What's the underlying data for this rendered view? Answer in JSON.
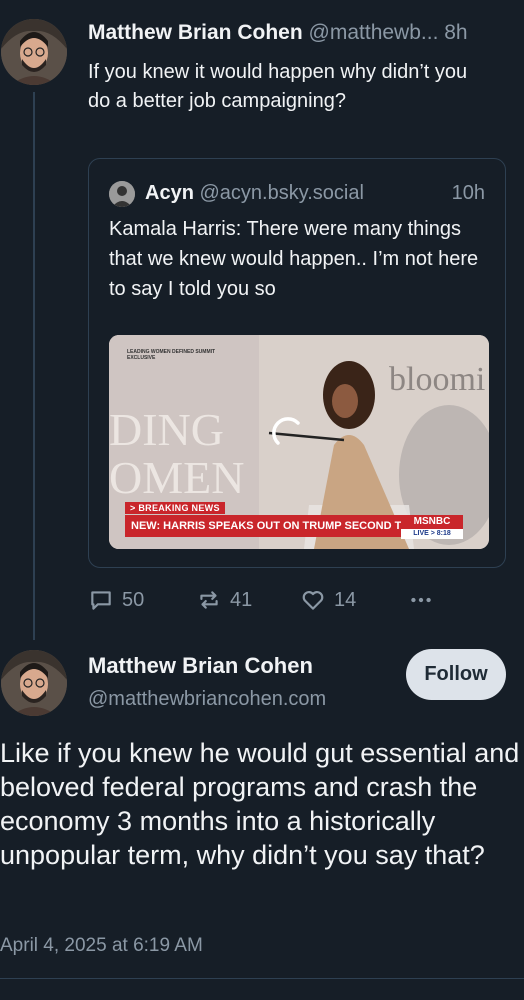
{
  "reply": {
    "author_name": "Matthew Brian Cohen",
    "author_handle": "@matthewb...",
    "time": "8h",
    "text": "If you knew it would happen why didn’t you do a better job campaigning?"
  },
  "quote": {
    "author_name": "Acyn",
    "author_handle": "@acyn.bsky.social",
    "time": "10h",
    "text": "Kamala Harris: There were many things that we knew would happen.. I’m not here to say I told you so",
    "video": {
      "tag_top": "LEADING WOMEN DEFINED SUMMIT\nEXCLUSIVE",
      "breaking_label": "> BREAKING NEWS",
      "headline": "NEW: HARRIS SPEAKS OUT ON TRUMP SECOND TERM CHAOS",
      "network": "MSNBC",
      "live_label": "LIVE > 8:18"
    }
  },
  "actions": {
    "reply_count": "50",
    "repost_count": "41",
    "like_count": "14",
    "reply_icon": "speech-bubble-icon",
    "repost_icon": "repost-arrows-icon",
    "like_icon": "heart-icon",
    "more_icon": "more-dots-icon"
  },
  "main_post": {
    "author_name": "Matthew Brian Cohen",
    "author_handle": "@matthewbriancohen.com",
    "follow_label": "Follow",
    "text": "Like if you knew he would gut essential and beloved federal programs and crash the economy 3 months into a historically unpopular term, why didn’t you say that?",
    "date": "April 4, 2025 at 6:19 AM"
  },
  "colors": {
    "background": "#161e27",
    "muted_text": "#8b98a5",
    "border": "#2e4052",
    "follow_button_bg": "#dde3ea",
    "breaking_red": "#c9262b"
  }
}
